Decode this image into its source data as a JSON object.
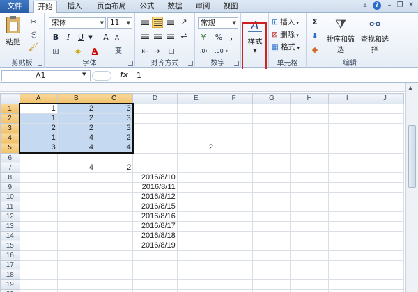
{
  "tabs": [
    {
      "label": "文件"
    },
    {
      "label": "开始"
    },
    {
      "label": "插入"
    },
    {
      "label": "页面布局"
    },
    {
      "label": "公式"
    },
    {
      "label": "数据"
    },
    {
      "label": "审阅"
    },
    {
      "label": "视图"
    }
  ],
  "ribbon": {
    "clipboard": {
      "paste": "粘贴",
      "group": "剪贴板"
    },
    "font": {
      "name": "宋体",
      "size": "11",
      "bold": "B",
      "italic": "I",
      "underline": "U",
      "group": "字体",
      "grow": "A",
      "shrink": "A",
      "wen": "变"
    },
    "align": {
      "group": "对齐方式"
    },
    "number": {
      "format": "常规",
      "percent": "%",
      "comma": ",",
      "group": "数字"
    },
    "styles": {
      "label": "样式"
    },
    "cells": {
      "insert": "插入",
      "delete": "删除",
      "format": "格式",
      "group": "单元格"
    },
    "editing": {
      "sum": "Σ",
      "sort": "排序和筛选",
      "find": "查找和选择",
      "group": "编辑"
    }
  },
  "formula_bar": {
    "name_box": "A1",
    "fx": "fx",
    "value": "1"
  },
  "columns": [
    "A",
    "B",
    "C",
    "D",
    "E",
    "F",
    "G",
    "H",
    "I",
    "J"
  ],
  "rows": [
    {
      "n": "1",
      "A": "1",
      "B": "2",
      "C": "3",
      "D": "",
      "E": ""
    },
    {
      "n": "2",
      "A": "1",
      "B": "2",
      "C": "3",
      "D": "",
      "E": ""
    },
    {
      "n": "3",
      "A": "2",
      "B": "2",
      "C": "3",
      "D": "",
      "E": ""
    },
    {
      "n": "4",
      "A": "1",
      "B": "4",
      "C": "2",
      "D": "",
      "E": ""
    },
    {
      "n": "5",
      "A": "3",
      "B": "4",
      "C": "4",
      "D": "",
      "E": "2"
    },
    {
      "n": "6",
      "A": "",
      "B": "",
      "C": "",
      "D": "",
      "E": ""
    },
    {
      "n": "7",
      "A": "",
      "B": "4",
      "C": "2",
      "D": "",
      "E": ""
    },
    {
      "n": "8",
      "A": "",
      "B": "",
      "C": "",
      "D": "2016/8/10",
      "E": ""
    },
    {
      "n": "9",
      "A": "",
      "B": "",
      "C": "",
      "D": "2016/8/11",
      "E": ""
    },
    {
      "n": "10",
      "A": "",
      "B": "",
      "C": "",
      "D": "2016/8/12",
      "E": ""
    },
    {
      "n": "11",
      "A": "",
      "B": "",
      "C": "",
      "D": "2016/8/15",
      "E": ""
    },
    {
      "n": "12",
      "A": "",
      "B": "",
      "C": "",
      "D": "2016/8/16",
      "E": ""
    },
    {
      "n": "13",
      "A": "",
      "B": "",
      "C": "",
      "D": "2016/8/17",
      "E": ""
    },
    {
      "n": "14",
      "A": "",
      "B": "",
      "C": "",
      "D": "2016/8/18",
      "E": ""
    },
    {
      "n": "15",
      "A": "",
      "B": "",
      "C": "",
      "D": "2016/8/19",
      "E": ""
    },
    {
      "n": "16",
      "A": "",
      "B": "",
      "C": "",
      "D": "",
      "E": ""
    },
    {
      "n": "17",
      "A": "",
      "B": "",
      "C": "",
      "D": "",
      "E": ""
    },
    {
      "n": "18",
      "A": "",
      "B": "",
      "C": "",
      "D": "",
      "E": ""
    },
    {
      "n": "19",
      "A": "",
      "B": "",
      "C": "",
      "D": "",
      "E": ""
    },
    {
      "n": "20",
      "A": "",
      "B": "",
      "C": "",
      "D": "",
      "E": ""
    }
  ],
  "colors": {
    "selection": "#c5d9f1",
    "header_selected": "#f1c16a",
    "highlight_border": "#d02020",
    "file_tab": "#2a5ea8"
  }
}
